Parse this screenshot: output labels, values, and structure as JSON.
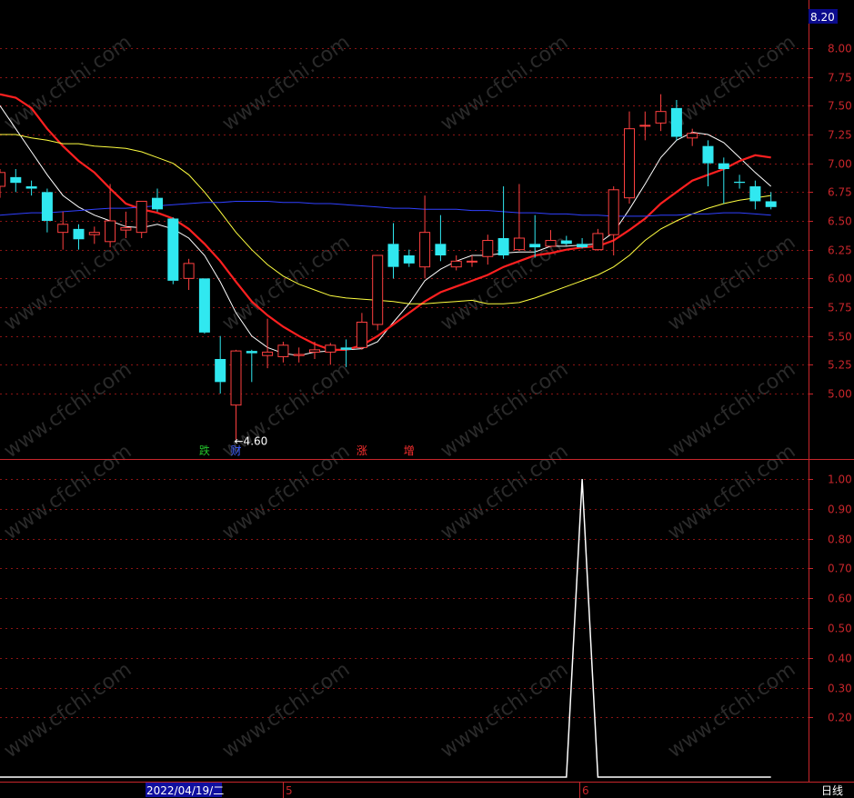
{
  "chart_data": [
    {
      "type": "candlestick",
      "panel": "price",
      "ylim": [
        4.55,
        8.25
      ],
      "y_ticks": [
        "8.00",
        "7.75",
        "7.50",
        "7.25",
        "7.00",
        "6.75",
        "6.50",
        "6.25",
        "6.00",
        "5.75",
        "5.50",
        "5.25",
        "5.00"
      ],
      "y_top_label": "8.20",
      "candles": [
        {
          "o": 6.8,
          "h": 6.95,
          "l": 6.7,
          "c": 6.92
        },
        {
          "o": 6.88,
          "h": 6.95,
          "l": 6.75,
          "c": 6.83
        },
        {
          "o": 6.8,
          "h": 6.85,
          "l": 6.72,
          "c": 6.78
        },
        {
          "o": 6.75,
          "h": 6.78,
          "l": 6.4,
          "c": 6.5
        },
        {
          "o": 6.4,
          "h": 6.58,
          "l": 6.25,
          "c": 6.47
        },
        {
          "o": 6.43,
          "h": 6.47,
          "l": 6.25,
          "c": 6.34
        },
        {
          "o": 6.38,
          "h": 6.45,
          "l": 6.3,
          "c": 6.4
        },
        {
          "o": 6.32,
          "h": 6.82,
          "l": 6.27,
          "c": 6.5
        },
        {
          "o": 6.42,
          "h": 6.58,
          "l": 6.35,
          "c": 6.44
        },
        {
          "o": 6.4,
          "h": 6.67,
          "l": 6.35,
          "c": 6.67
        },
        {
          "o": 6.7,
          "h": 6.78,
          "l": 6.58,
          "c": 6.6
        },
        {
          "o": 6.52,
          "h": 6.53,
          "l": 5.95,
          "c": 5.98
        },
        {
          "o": 6.0,
          "h": 6.17,
          "l": 5.9,
          "c": 6.13
        },
        {
          "o": 6.0,
          "h": 6.0,
          "l": 5.52,
          "c": 5.53
        },
        {
          "o": 5.3,
          "h": 5.5,
          "l": 5.0,
          "c": 5.1
        },
        {
          "o": 4.9,
          "h": 5.38,
          "l": 4.6,
          "c": 5.37
        },
        {
          "o": 5.37,
          "h": 5.38,
          "l": 5.1,
          "c": 5.35
        },
        {
          "o": 5.33,
          "h": 5.65,
          "l": 5.22,
          "c": 5.36
        },
        {
          "o": 5.32,
          "h": 5.45,
          "l": 5.27,
          "c": 5.42
        },
        {
          "o": 5.33,
          "h": 5.4,
          "l": 5.27,
          "c": 5.34
        },
        {
          "o": 5.36,
          "h": 5.45,
          "l": 5.3,
          "c": 5.38
        },
        {
          "o": 5.36,
          "h": 5.44,
          "l": 5.25,
          "c": 5.42
        },
        {
          "o": 5.4,
          "h": 5.47,
          "l": 5.23,
          "c": 5.38
        },
        {
          "o": 5.4,
          "h": 5.7,
          "l": 5.38,
          "c": 5.62
        },
        {
          "o": 5.6,
          "h": 6.2,
          "l": 5.55,
          "c": 6.2
        },
        {
          "o": 6.3,
          "h": 6.48,
          "l": 6.0,
          "c": 6.1
        },
        {
          "o": 6.2,
          "h": 6.25,
          "l": 6.1,
          "c": 6.13
        },
        {
          "o": 6.1,
          "h": 6.72,
          "l": 6.0,
          "c": 6.4
        },
        {
          "o": 6.3,
          "h": 6.55,
          "l": 6.15,
          "c": 6.2
        },
        {
          "o": 6.1,
          "h": 6.2,
          "l": 6.07,
          "c": 6.15
        },
        {
          "o": 6.15,
          "h": 6.2,
          "l": 6.1,
          "c": 6.15
        },
        {
          "o": 6.19,
          "h": 6.38,
          "l": 6.12,
          "c": 6.33
        },
        {
          "o": 6.35,
          "h": 6.8,
          "l": 6.17,
          "c": 6.2
        },
        {
          "o": 6.25,
          "h": 6.82,
          "l": 6.24,
          "c": 6.35
        },
        {
          "o": 6.3,
          "h": 6.55,
          "l": 6.18,
          "c": 6.27
        },
        {
          "o": 6.28,
          "h": 6.42,
          "l": 6.27,
          "c": 6.33
        },
        {
          "o": 6.33,
          "h": 6.37,
          "l": 6.29,
          "c": 6.3
        },
        {
          "o": 6.3,
          "h": 6.35,
          "l": 6.26,
          "c": 6.27
        },
        {
          "o": 6.25,
          "h": 6.43,
          "l": 6.24,
          "c": 6.39
        },
        {
          "o": 6.38,
          "h": 6.8,
          "l": 6.2,
          "c": 6.77
        },
        {
          "o": 6.7,
          "h": 7.45,
          "l": 6.65,
          "c": 7.3
        },
        {
          "o": 7.33,
          "h": 7.45,
          "l": 7.2,
          "c": 7.33
        },
        {
          "o": 7.35,
          "h": 7.6,
          "l": 7.28,
          "c": 7.45
        },
        {
          "o": 7.48,
          "h": 7.55,
          "l": 7.2,
          "c": 7.23
        },
        {
          "o": 7.22,
          "h": 7.3,
          "l": 7.15,
          "c": 7.26
        },
        {
          "o": 7.15,
          "h": 7.2,
          "l": 6.8,
          "c": 7.0
        },
        {
          "o": 7.0,
          "h": 7.05,
          "l": 6.65,
          "c": 6.95
        },
        {
          "o": 6.84,
          "h": 6.9,
          "l": 6.78,
          "c": 6.83
        },
        {
          "o": 6.8,
          "h": 6.85,
          "l": 6.6,
          "c": 6.67
        },
        {
          "o": 6.67,
          "h": 6.75,
          "l": 6.6,
          "c": 6.62
        }
      ],
      "ma_series": [
        {
          "color": "#ffffff",
          "values": [
            7.5,
            7.3,
            7.1,
            6.9,
            6.72,
            6.62,
            6.55,
            6.5,
            6.45,
            6.44,
            6.47,
            6.43,
            6.35,
            6.2,
            5.97,
            5.7,
            5.5,
            5.4,
            5.35,
            5.33,
            5.36,
            5.37,
            5.38,
            5.39,
            5.45,
            5.62,
            5.78,
            5.98,
            6.08,
            6.15,
            6.2,
            6.2,
            6.22,
            6.23,
            6.23,
            6.28,
            6.28,
            6.29,
            6.3,
            6.4,
            6.6,
            6.82,
            7.05,
            7.2,
            7.27,
            7.25,
            7.18,
            7.05,
            6.92,
            6.8
          ]
        },
        {
          "color": "#ff2020",
          "values": [
            7.6,
            7.57,
            7.48,
            7.3,
            7.15,
            7.02,
            6.92,
            6.78,
            6.65,
            6.6,
            6.57,
            6.52,
            6.43,
            6.3,
            6.15,
            5.97,
            5.8,
            5.68,
            5.58,
            5.5,
            5.43,
            5.38,
            5.38,
            5.42,
            5.5,
            5.6,
            5.7,
            5.8,
            5.88,
            5.93,
            5.98,
            6.03,
            6.1,
            6.15,
            6.2,
            6.22,
            6.25,
            6.27,
            6.28,
            6.33,
            6.42,
            6.52,
            6.65,
            6.75,
            6.85,
            6.9,
            6.95,
            7.02,
            7.07,
            7.05
          ]
        },
        {
          "color": "#ffff40",
          "values": [
            7.25,
            7.25,
            7.22,
            7.2,
            7.17,
            7.17,
            7.15,
            7.14,
            7.13,
            7.1,
            7.05,
            7.0,
            6.9,
            6.75,
            6.58,
            6.4,
            6.25,
            6.12,
            6.02,
            5.95,
            5.9,
            5.85,
            5.83,
            5.82,
            5.81,
            5.8,
            5.78,
            5.78,
            5.79,
            5.8,
            5.81,
            5.78,
            5.78,
            5.79,
            5.83,
            5.88,
            5.93,
            5.98,
            6.03,
            6.1,
            6.2,
            6.33,
            6.43,
            6.5,
            6.56,
            6.61,
            6.65,
            6.68,
            6.7,
            6.72
          ]
        },
        {
          "color": "#3040ff",
          "values": [
            6.55,
            6.56,
            6.57,
            6.57,
            6.58,
            6.59,
            6.6,
            6.61,
            6.61,
            6.62,
            6.63,
            6.64,
            6.65,
            6.66,
            6.66,
            6.67,
            6.67,
            6.67,
            6.66,
            6.66,
            6.65,
            6.65,
            6.64,
            6.63,
            6.62,
            6.61,
            6.61,
            6.6,
            6.6,
            6.6,
            6.59,
            6.59,
            6.58,
            6.57,
            6.57,
            6.56,
            6.56,
            6.55,
            6.55,
            6.54,
            6.54,
            6.54,
            6.55,
            6.55,
            6.56,
            6.56,
            6.57,
            6.57,
            6.56,
            6.55
          ]
        }
      ],
      "low_annotation": {
        "index": 15,
        "text": "←4.60"
      },
      "event_markers": [
        {
          "index": 13,
          "text": "跌",
          "color": "#22c22a"
        },
        {
          "index": 15,
          "text": "财",
          "color": "#4060ff"
        },
        {
          "index": 23,
          "text": "涨",
          "color": "#ff3030"
        },
        {
          "index": 26,
          "text": "增",
          "color": "#ff3030"
        }
      ]
    },
    {
      "type": "line",
      "panel": "indicator",
      "ylim": [
        0,
        1.05
      ],
      "y_ticks": [
        "1.00",
        "0.90",
        "0.80",
        "0.70",
        "0.60",
        "0.50",
        "0.40",
        "0.30",
        "0.20"
      ],
      "values": [
        0,
        0,
        0,
        0,
        0,
        0,
        0,
        0,
        0,
        0,
        0,
        0,
        0,
        0,
        0,
        0,
        0,
        0,
        0,
        0,
        0,
        0,
        0,
        0,
        0,
        0,
        0,
        0,
        0,
        0,
        0,
        0,
        0,
        0,
        0,
        0,
        0,
        1,
        0,
        0,
        0,
        0,
        0,
        0,
        0,
        0,
        0,
        0,
        0,
        0
      ]
    }
  ],
  "x_axis": {
    "date_label": "2022/04/19/二",
    "month_labels": [
      "5",
      "6"
    ],
    "period_label": "日线"
  },
  "watermark": "www.cfchi.com",
  "colors": {
    "background": "#000000",
    "grid": "#8a1414",
    "axis": "#c8262b",
    "candle_up": "#ff4040",
    "candle_down": "#30e8f0",
    "indicator_line": "#ffffff"
  }
}
